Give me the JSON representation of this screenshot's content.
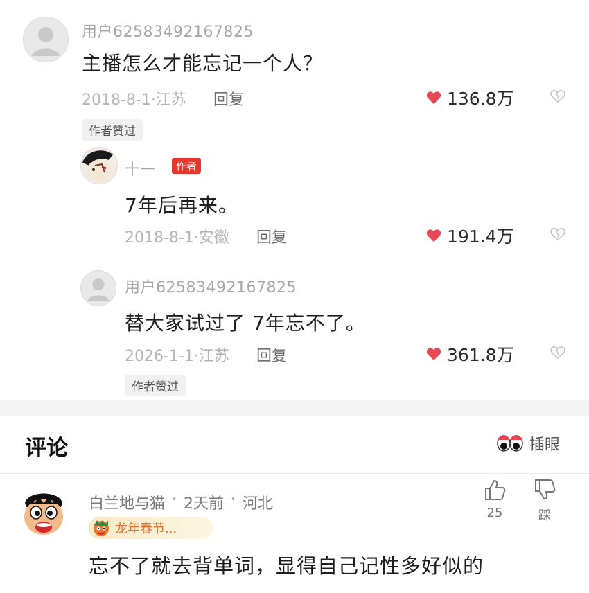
{
  "comments": {
    "top": {
      "username": "用户62583492167825",
      "content": "主播怎么才能忘记一个人？",
      "meta": "2018-8-1·江苏",
      "reply_label": "回复",
      "likes": "136.8万",
      "author_liked": "作者赞过"
    },
    "reply1": {
      "username": "十一",
      "badge": "作者",
      "content": "7年后再来。",
      "meta": "2018-8-1·安徽",
      "reply_label": "回复",
      "likes": "191.4万"
    },
    "reply2": {
      "username": "用户62583492167825",
      "content": "替大家试过了 7年忘不了。",
      "meta": "2026-1-1·江苏",
      "reply_label": "回复",
      "likes": "361.8万",
      "author_liked": "作者赞过"
    }
  },
  "section": {
    "title": "评论",
    "action_label": "插眼"
  },
  "bottom_comment": {
    "username": "白兰地与猫",
    "time": "2天前",
    "location": "河北",
    "badge": "龙年春节...",
    "content": "忘不了就去背单词，显得自己记性多好似的",
    "like_count": "25",
    "dislike_label": "踩"
  },
  "colors": {
    "heart": "#e84855",
    "badge_red": "#e8372f",
    "badge_orange": "#e8752f"
  }
}
